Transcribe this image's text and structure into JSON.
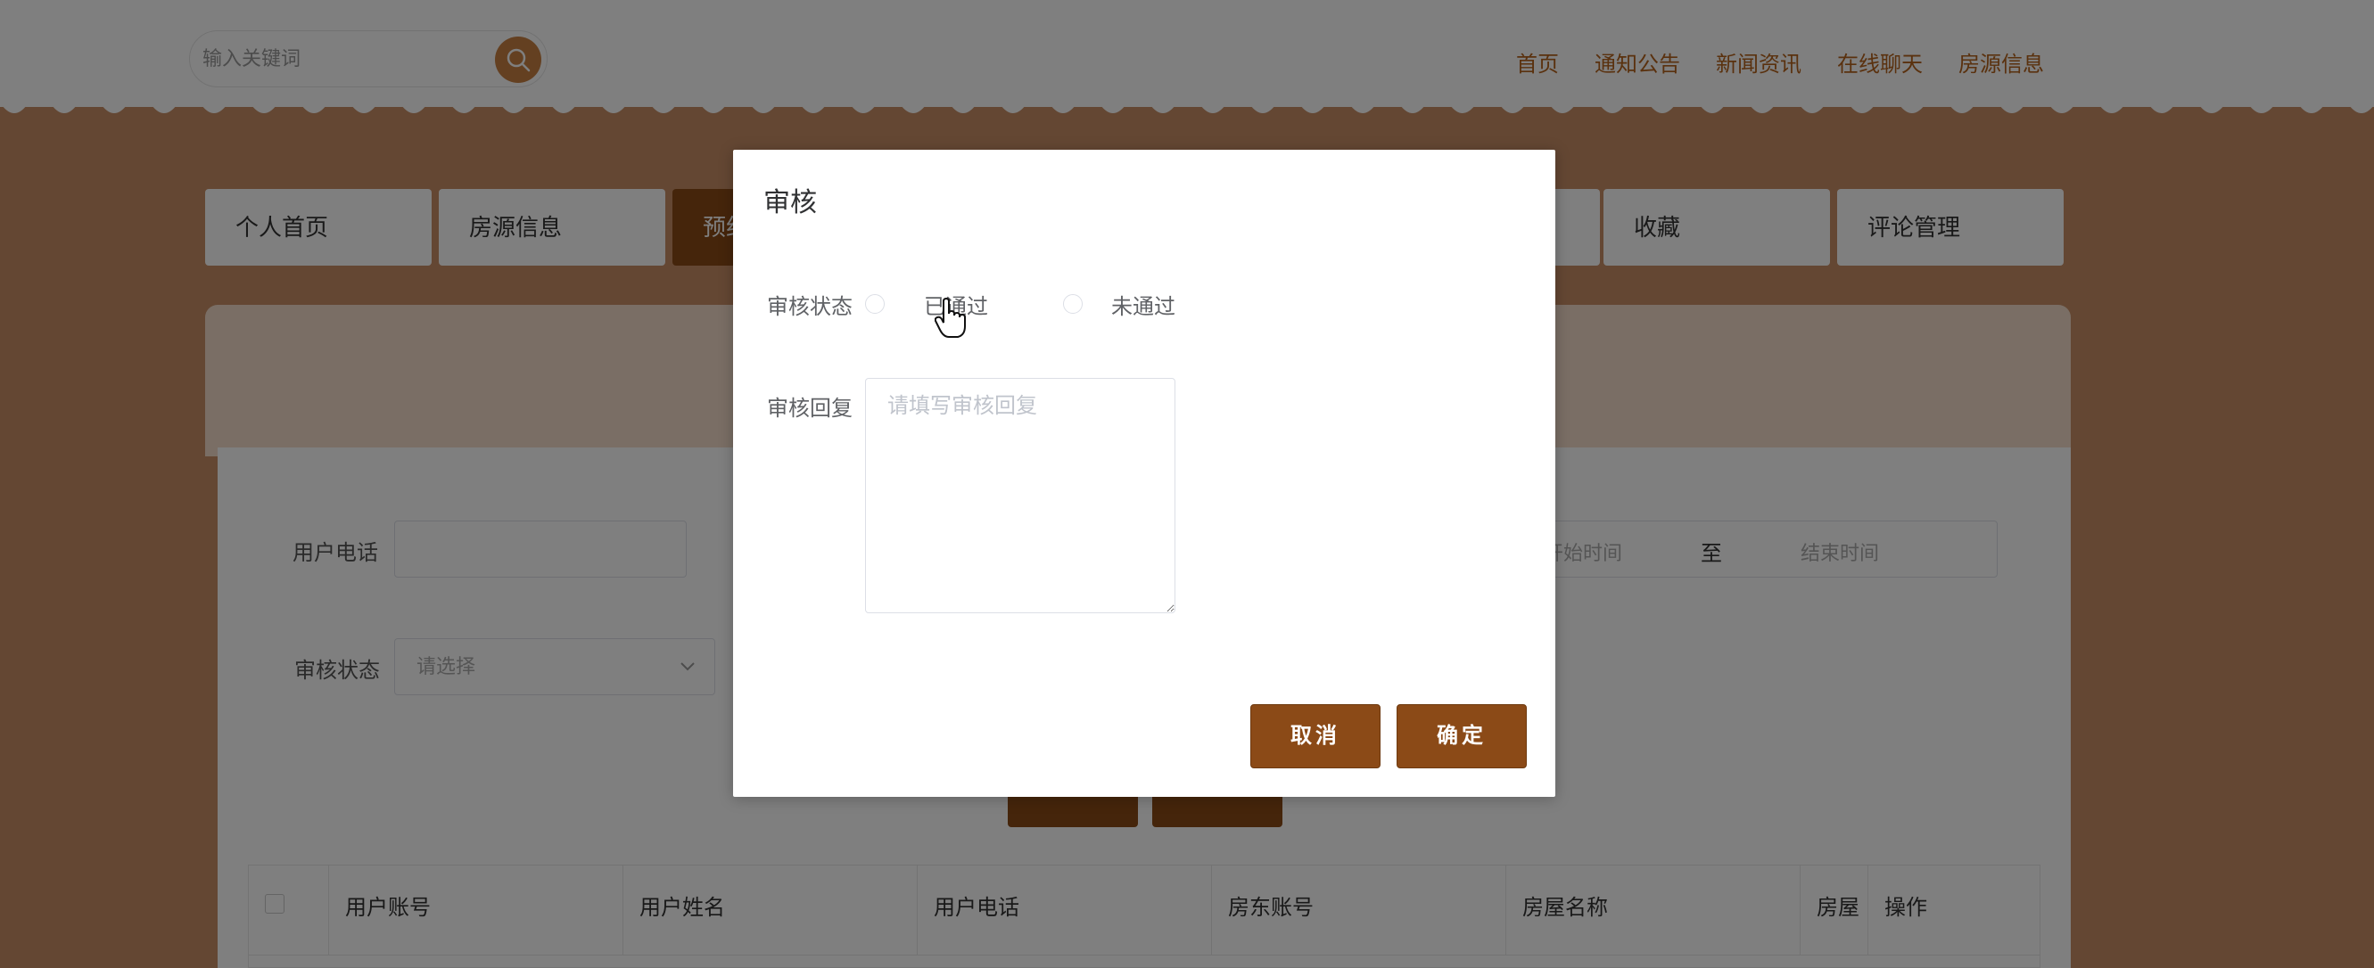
{
  "header": {
    "search_placeholder": "输入关键词",
    "search_icon": "search-icon",
    "nav": [
      "首页",
      "通知公告",
      "新闻资讯",
      "在线聊天",
      "房源信息"
    ]
  },
  "tabs": [
    {
      "label": "个人首页",
      "active": false
    },
    {
      "label": "房源信息",
      "active": false
    },
    {
      "label": "预约看房",
      "active": true
    },
    {
      "label": "",
      "active": false
    },
    {
      "label": "",
      "active": false
    },
    {
      "label": "",
      "active": false
    },
    {
      "label": "收藏",
      "active": false
    },
    {
      "label": "评论管理",
      "active": false
    }
  ],
  "filters": {
    "phone_label": "用户电话",
    "status_label": "审核状态",
    "status_placeholder": "请选择",
    "date_start": "开始时间",
    "date_sep": "至",
    "date_end": "结束时间"
  },
  "table": {
    "headers": [
      "用户账号",
      "用户姓名",
      "用户电话",
      "房东账号",
      "房屋名称",
      "房屋",
      "操作"
    ]
  },
  "dialog": {
    "title": "审核",
    "status_label": "审核状态",
    "options": [
      "已通过",
      "未通过"
    ],
    "reply_label": "审核回复",
    "reply_placeholder": "请填写审核回复",
    "cancel_label": "取消",
    "confirm_label": "确定"
  },
  "colors": {
    "accent": "#8b4a17",
    "nav_text": "#b5621c",
    "background": "#c98f66"
  }
}
